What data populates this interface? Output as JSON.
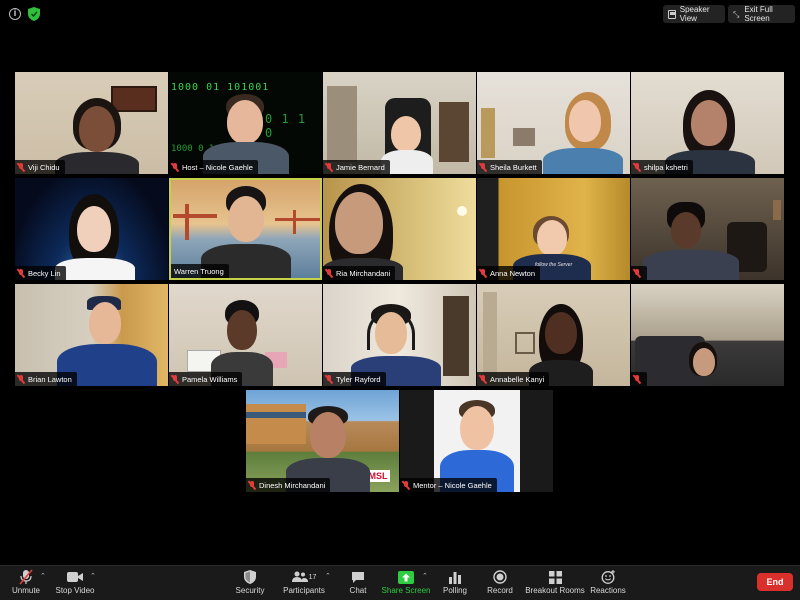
{
  "topbar": {
    "speaker_view": "Speaker View",
    "exit_full_screen": "Exit Full Screen"
  },
  "participants": [
    {
      "name": "Viji Chidu"
    },
    {
      "name": "Host – Nicole Gaehle"
    },
    {
      "name": "Jamie Bernard"
    },
    {
      "name": "Sheila Burkett"
    },
    {
      "name": "shilpa kshetri"
    },
    {
      "name": "Becky Lin"
    },
    {
      "name": "Warren Truong"
    },
    {
      "name": "Ria Mirchandani"
    },
    {
      "name": "Anna Newton"
    },
    {
      "name": ""
    },
    {
      "name": "Brian Lawton"
    },
    {
      "name": "Pamela Williams"
    },
    {
      "name": "Tyler Rayford"
    },
    {
      "name": "Annabelle Kanyi"
    },
    {
      "name": ""
    },
    {
      "name": "Dinesh Mirchandani"
    },
    {
      "name": "Mentor – Nicole Gaehle"
    }
  ],
  "background_text": {
    "binary_code": "1000 01 101001",
    "binary_code_2": "1000 0 1",
    "binary_code_3": "0 1 1 0",
    "shirt_text": "follow the Server",
    "sign_text": "MSL"
  },
  "toolbar": {
    "unmute": "Unmute",
    "stop_video": "Stop Video",
    "security": "Security",
    "participants": "Participants",
    "participants_count": "17",
    "chat": "Chat",
    "share_screen": "Share Screen",
    "polling": "Polling",
    "record": "Record",
    "breakout_rooms": "Breakout Rooms",
    "reactions": "Reactions",
    "end": "End"
  },
  "colors": {
    "active_speaker_border": "#c6d14a",
    "share_screen_green": "#2ecc40",
    "end_red": "#d9302c",
    "muted_red": "#e23b3b"
  }
}
